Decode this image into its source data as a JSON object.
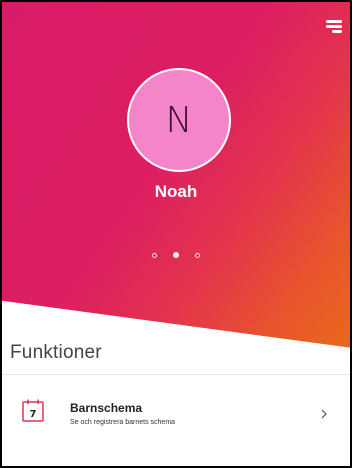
{
  "profile": {
    "initial": "N",
    "name": "Noah"
  },
  "carousel": {
    "page_count": 3,
    "active_index": 1
  },
  "functions": {
    "title": "Funktioner",
    "items": [
      {
        "title": "Barnschema",
        "subtitle": "Se och registrera barnets schema",
        "icon_day": "7",
        "icon": "calendar-icon"
      }
    ]
  },
  "colors": {
    "hero_start": "#d81b66",
    "hero_end": "#ea6a1a",
    "avatar_fill": "#f585c9",
    "icon_accent": "#e3344c"
  }
}
